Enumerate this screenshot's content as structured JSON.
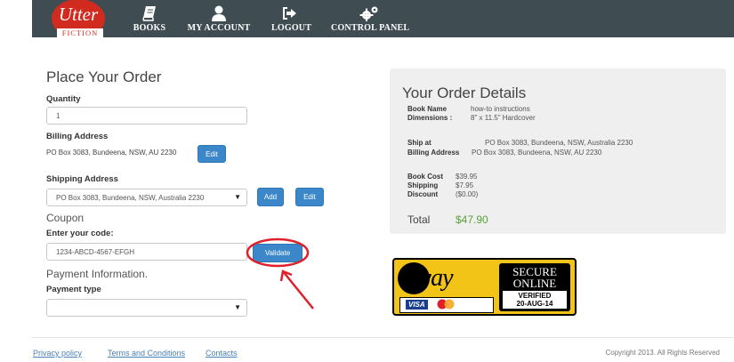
{
  "brand": {
    "name_top": "Utter",
    "name_bottom": "FICTION"
  },
  "nav": [
    {
      "label": "BOOKS",
      "icon": "book-icon"
    },
    {
      "label": "MY ACCOUNT",
      "icon": "user-icon"
    },
    {
      "label": "LOGOUT",
      "icon": "logout-icon"
    },
    {
      "label": "CONTROL PANEL",
      "icon": "gears-icon"
    }
  ],
  "order_form": {
    "title": "Place Your Order",
    "quantity_label": "Quantity",
    "quantity_value": "1",
    "billing_label": "Billing Address",
    "billing_value": "PO Box 3083, Bundeena, NSW, AU 2230",
    "edit_label": "Edit",
    "shipping_label": "Shipping Address",
    "shipping_value": "PO Box 3083, Bundeena, NSW, Australia 2230",
    "add_label": "Add",
    "coupon_heading": "Coupon",
    "coupon_label": "Enter your code:",
    "coupon_value": "1234-ABCD-4567-EFGH",
    "validate_label": "Validate",
    "payment_heading": "Payment Information.",
    "payment_type_label": "Payment type",
    "payment_type_value": ""
  },
  "details": {
    "title": "Your Order Details",
    "book_name_key": "Book Name",
    "book_name_val": "how-to instructions",
    "dimensions_key": "Dimensions :",
    "dimensions_val": "8\" x 11.5\" Hardcover",
    "ship_at_key": "Ship at",
    "ship_at_val": "PO Box 3083, Bundeena, NSW, Australia 2230",
    "billing_key": "Billing Address",
    "billing_val": "PO Box 3083, Bundeena, NSW, AU 2230",
    "book_cost_key": "Book Cost",
    "book_cost_val": "$39.95",
    "shipping_key": "Shipping",
    "shipping_val": "$7.95",
    "discount_key": "Discount",
    "discount_val": "($0.00)",
    "total_key": "Total",
    "total_val": "$47.90"
  },
  "eway": {
    "logo_text": "eway",
    "secure": "SECURE",
    "online": "ONLINE",
    "verified": "VERIFIED",
    "date": "20-AUG-14",
    "visa": "VISA"
  },
  "footer": {
    "privacy": "Privacy policy",
    "terms": "Terms and Conditions",
    "contacts": "Contacts",
    "copyright": "Copyright 2013. All Rights Reserved"
  },
  "colors": {
    "navbar": "#3f4d52",
    "brand_red": "#d12a1f",
    "button_blue": "#3b87c9",
    "total_green": "#5aa13a",
    "annotation_red": "#e0202a",
    "eway_yellow": "#f2c418"
  }
}
